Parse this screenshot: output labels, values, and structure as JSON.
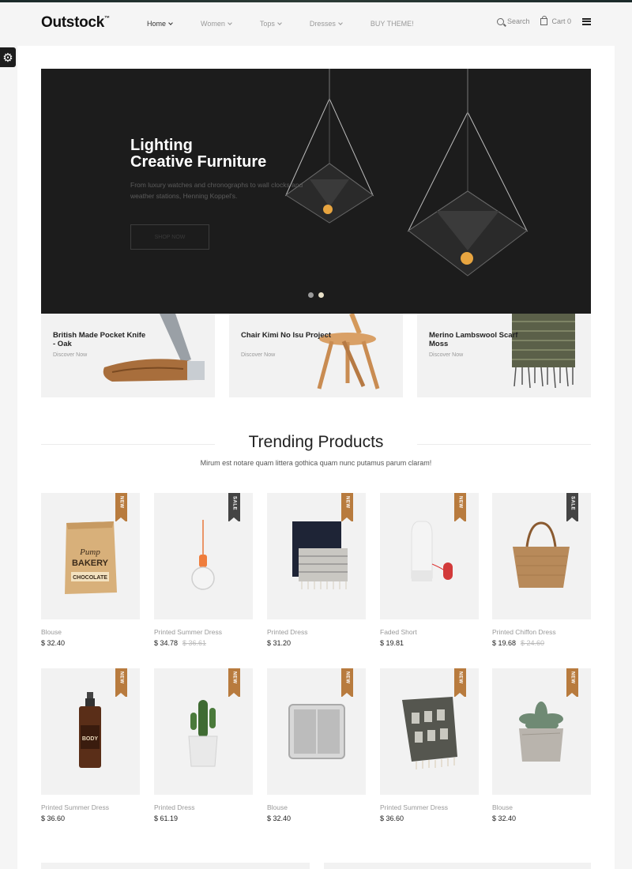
{
  "header": {
    "logo": "Outstock",
    "logo_tm": "™",
    "nav": [
      {
        "label": "Home",
        "dropdown": true,
        "active": true
      },
      {
        "label": "Women",
        "dropdown": true,
        "active": false
      },
      {
        "label": "Tops",
        "dropdown": true,
        "active": false
      },
      {
        "label": "Dresses",
        "dropdown": true,
        "active": false
      },
      {
        "label": "BUY THEME!",
        "dropdown": false,
        "active": false
      }
    ],
    "search_label": "Search",
    "cart_label": "Cart 0"
  },
  "hero": {
    "title_line1": "Lighting",
    "title_line2": "Creative Furniture",
    "description": "From luxury watches and chronographs to wall clocks and weather  stations, Henning Koppel's.",
    "button_label": "SHOP NOW",
    "slides": 2,
    "active_slide": 2
  },
  "banners": [
    {
      "title": "British Made Pocket Knife - Oak",
      "link": "Discover Now"
    },
    {
      "title": "Chair Kimi No Isu Project",
      "link": "Discover Now"
    },
    {
      "title": "Merino Lambswool Scarf Moss",
      "link": "Discover Now"
    }
  ],
  "trending": {
    "title": "Trending Products",
    "subtitle": "Mirum est notare quam littera gothica quam nunc putamus parum claram!",
    "products": [
      {
        "name": "Blouse",
        "price": "$ 32.40",
        "old_price": "",
        "badge": "NEW",
        "image": "bakery-chocolate-bag"
      },
      {
        "name": "Printed Summer Dress",
        "price": "$ 34.78",
        "old_price": "$ 36.61",
        "badge": "SALE",
        "image": "pendant-bulb-lamp"
      },
      {
        "name": "Printed Dress",
        "price": "$ 31.20",
        "old_price": "",
        "badge": "NEW",
        "image": "folded-blanket"
      },
      {
        "name": "Faded Short",
        "price": "$ 19.81",
        "old_price": "",
        "badge": "NEW",
        "image": "white-lamp"
      },
      {
        "name": "Printed Chiffon Dress",
        "price": "$ 19.68",
        "old_price": "$ 24.60",
        "badge": "SALE",
        "image": "woven-tote-bag"
      },
      {
        "name": "Printed Summer Dress",
        "price": "$ 36.60",
        "old_price": "",
        "badge": "NEW",
        "image": "body-oil-bottle"
      },
      {
        "name": "Printed Dress",
        "price": "$ 61.19",
        "old_price": "",
        "badge": "NEW",
        "image": "potted-cactus"
      },
      {
        "name": "Blouse",
        "price": "$ 32.40",
        "old_price": "",
        "badge": "NEW",
        "image": "metal-tray"
      },
      {
        "name": "Printed Summer Dress",
        "price": "$ 36.60",
        "old_price": "",
        "badge": "NEW",
        "image": "patterned-towel"
      },
      {
        "name": "Blouse",
        "price": "$ 32.40",
        "old_price": "",
        "badge": "NEW",
        "image": "succulent-paper-pot"
      }
    ]
  },
  "colors": {
    "accent_new": "#b87b3e",
    "accent_sale": "#444444",
    "hero_bg": "#1c1c1c"
  }
}
